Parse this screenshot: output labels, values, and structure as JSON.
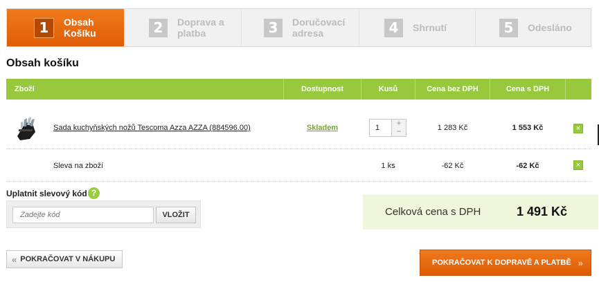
{
  "steps": [
    {
      "num": "1",
      "line1": "Obsah",
      "line2": "Košíku",
      "active": true
    },
    {
      "num": "2",
      "line1": "Doprava a",
      "line2": "platba",
      "active": false
    },
    {
      "num": "3",
      "line1": "Doručovací",
      "line2": "adresa",
      "active": false
    },
    {
      "num": "4",
      "line1": "Shrnutí",
      "line2": "",
      "active": false
    },
    {
      "num": "5",
      "line1": "Odesláno",
      "line2": "",
      "active": false
    }
  ],
  "page_title": "Obsah košíku",
  "table": {
    "headers": {
      "product": "Zboží",
      "availability": "Dostupnost",
      "qty": "Kusů",
      "price_no_vat": "Cena bez DPH",
      "price_vat": "Cena s DPH"
    },
    "items": [
      {
        "name": "Sada kuchyňských nožů Tescoma Azza AZZA (884596.00)",
        "availability": "Skladem",
        "qty": "1",
        "price_no_vat": "1 283 Kč",
        "price_vat": "1 553 Kč",
        "remove": "×"
      }
    ],
    "discount": {
      "name": "Sleva na zboží",
      "qty": "1 ks",
      "price_no_vat": "-62 Kč",
      "price_vat": "-62 Kč",
      "remove": "×"
    }
  },
  "coupon": {
    "title": "Uplatnit slevový kód",
    "help": "?",
    "placeholder": "Zadejte kód",
    "button": "VLOŽIT"
  },
  "total": {
    "label": "Celková cena s DPH",
    "amount": "1 491 Kč"
  },
  "buttons": {
    "back": "POKRAČOVAT V NÁKUPU",
    "back_chevron": "«",
    "next": "POKRAČOVAT K DOPRAVĚ A PLATBĚ",
    "next_chevron": "»"
  },
  "icons": {
    "stepper_plus": "+",
    "stepper_minus": "−"
  },
  "colors": {
    "accent_orange": "#e8680f",
    "accent_green": "#98c93c"
  }
}
